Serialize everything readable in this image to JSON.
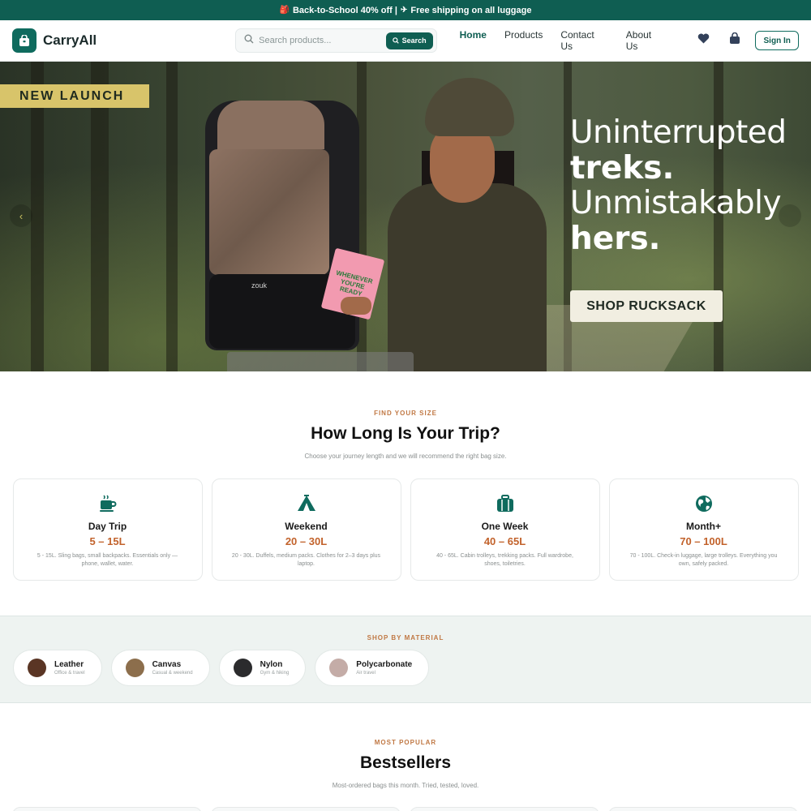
{
  "announcement": {
    "text1": "Back-to-School 40% off |",
    "text2": "Free shipping on all luggage"
  },
  "header": {
    "brand": "CarryAll",
    "search_placeholder": "Search products...",
    "search_button": "Search",
    "nav": [
      "Home",
      "Products",
      "Contact Us",
      "About Us"
    ],
    "signin": "Sign In"
  },
  "hero": {
    "badge": "NEW LAUNCH",
    "line1": "Uninterrupted",
    "line2": "treks.",
    "line3": "Unmistakably",
    "line4": "hers.",
    "cta": "SHOP RUCKSACK",
    "pack_logo": "zouk",
    "card_text": "WHENEVER YOU'RE READY"
  },
  "trip": {
    "eyebrow": "FIND YOUR SIZE",
    "title": "How Long Is Your Trip?",
    "subtitle": "Choose your journey length and we will recommend the right bag size.",
    "cards": [
      {
        "icon": "coffee-cup-icon",
        "name": "Day Trip",
        "size": "5 – 15L",
        "desc": "5 - 15L. Sling bags, small backpacks. Essentials only — phone, wallet, water."
      },
      {
        "icon": "tent-icon",
        "name": "Weekend",
        "size": "20 – 30L",
        "desc": "20 - 30L. Duffels, medium packs. Clothes for 2–3 days plus laptop."
      },
      {
        "icon": "suitcase-icon",
        "name": "One Week",
        "size": "40 – 65L",
        "desc": "40 - 65L. Cabin trolleys, trekking packs. Full wardrobe, shoes, toiletries."
      },
      {
        "icon": "globe-icon",
        "name": "Month+",
        "size": "70 – 100L",
        "desc": "70 - 100L. Check-in luggage, large trolleys. Everything you own, safely packed."
      }
    ]
  },
  "material": {
    "eyebrow": "SHOP BY MATERIAL",
    "items": [
      {
        "name": "Leather",
        "sub": "Office & travel",
        "color": "#5a3524"
      },
      {
        "name": "Canvas",
        "sub": "Casual & weekend",
        "color": "#8c6e4c"
      },
      {
        "name": "Nylon",
        "sub": "Gym & hiking",
        "color": "#2b2b2d"
      },
      {
        "name": "Polycarbonate",
        "sub": "Air travel",
        "color": "#c4aca7"
      }
    ]
  },
  "bestsellers": {
    "eyebrow": "MOST POPULAR",
    "title": "Bestsellers",
    "subtitle": "Most-ordered bags this month. Tried, tested, loved."
  },
  "colors": {
    "primary": "#0f5e52",
    "accent": "#c2622b",
    "badge": "#d8c46a"
  }
}
